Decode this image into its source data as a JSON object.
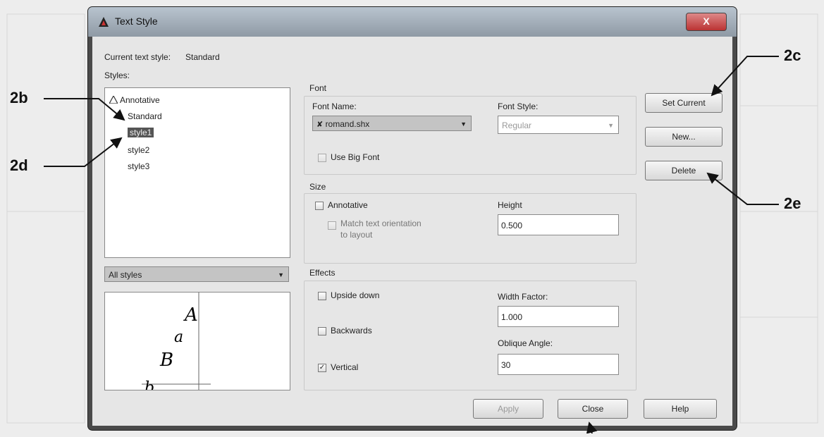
{
  "dialog": {
    "title": "Text Style",
    "close_glyph": "X",
    "current_style_label": "Current text style:",
    "current_style_value": "Standard"
  },
  "styles": {
    "label": "Styles:",
    "items": [
      {
        "name": "Annotative",
        "icon": "annotative-icon"
      },
      {
        "name": "Standard"
      },
      {
        "name": "style1",
        "selected": true
      },
      {
        "name": "style2"
      },
      {
        "name": "style3"
      }
    ],
    "filter": "All styles"
  },
  "font": {
    "group_label": "Font",
    "name_label": "Font Name:",
    "name_value": "romand.shx",
    "style_label": "Font Style:",
    "style_value": "Regular",
    "use_big_font_label": "Use Big Font",
    "use_big_font_checked": false
  },
  "size": {
    "group_label": "Size",
    "annotative_label": "Annotative",
    "annotative_checked": false,
    "match_orientation_label_1": "Match text orientation",
    "match_orientation_label_2": "to layout",
    "height_label": "Height",
    "height_value": "0.500"
  },
  "effects": {
    "group_label": "Effects",
    "upside_down_label": "Upside down",
    "upside_down_checked": false,
    "backwards_label": "Backwards",
    "backwards_checked": false,
    "vertical_label": "Vertical",
    "vertical_checked": true,
    "width_factor_label": "Width Factor:",
    "width_factor_value": "1.000",
    "oblique_label": "Oblique Angle:",
    "oblique_value": "30"
  },
  "preview_letters": [
    "A",
    "a",
    "B",
    "b"
  ],
  "buttons": {
    "set_current": "Set Current",
    "new": "New...",
    "delete": "Delete",
    "apply": "Apply",
    "close": "Close",
    "help": "Help"
  },
  "callouts": [
    "2b",
    "2d",
    "2c",
    "2e"
  ],
  "colors": {
    "titlebar": "#9aa6b1",
    "selection": "#555555",
    "close_button": "#c04040"
  }
}
